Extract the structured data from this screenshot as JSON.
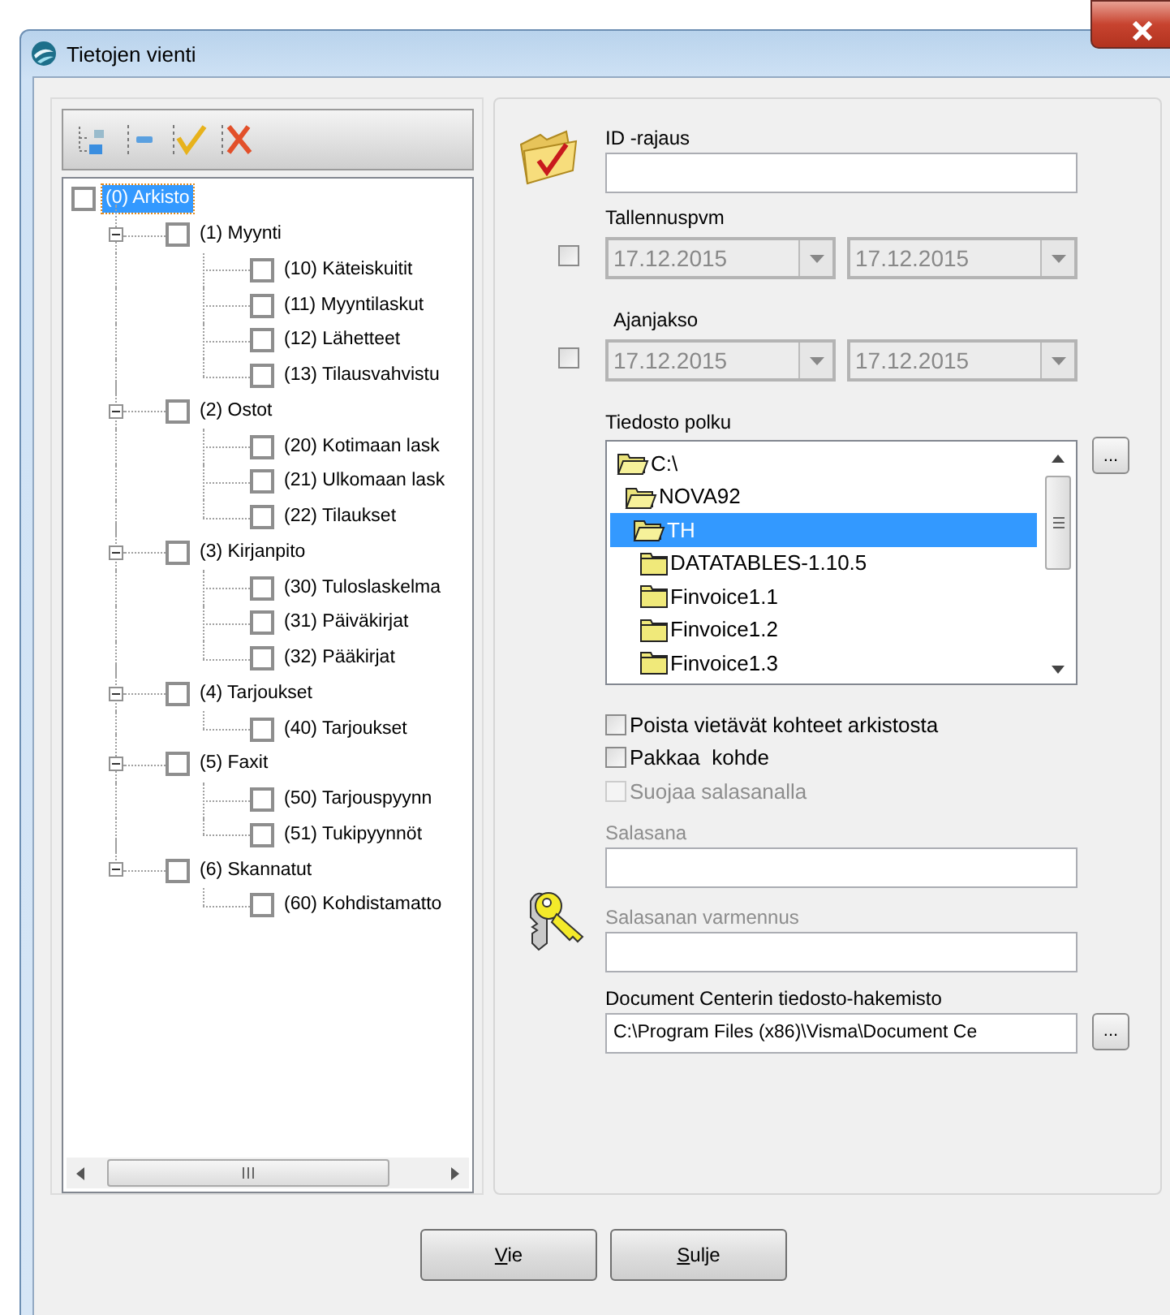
{
  "window": {
    "title": "Tietojen vienti"
  },
  "tree": {
    "items": [
      {
        "label": "(0) Arkisto",
        "checked": false,
        "selected": true,
        "children": [
          {
            "label": "(1) Myynti",
            "checked": false,
            "selected": false,
            "expanded": true,
            "children": [
              {
                "label": "(10) Käteiskuitit",
                "checked": false,
                "selected": false
              },
              {
                "label": "(11) Myyntilaskut",
                "checked": false,
                "selected": false
              },
              {
                "label": "(12) Lähetteet",
                "checked": false,
                "selected": false
              },
              {
                "label": "(13) Tilausvahvistu",
                "checked": false,
                "selected": false
              }
            ]
          },
          {
            "label": "(2) Ostot",
            "checked": false,
            "selected": false,
            "expanded": true,
            "children": [
              {
                "label": "(20) Kotimaan lask",
                "checked": false,
                "selected": false
              },
              {
                "label": "(21) Ulkomaan lask",
                "checked": false,
                "selected": false
              },
              {
                "label": "(22) Tilaukset",
                "checked": false,
                "selected": false
              }
            ]
          },
          {
            "label": "(3) Kirjanpito",
            "checked": false,
            "selected": false,
            "expanded": true,
            "children": [
              {
                "label": "(30) Tuloslaskelma",
                "checked": false,
                "selected": false
              },
              {
                "label": "(31) Päiväkirjat",
                "checked": false,
                "selected": false
              },
              {
                "label": "(32) Pääkirjat",
                "checked": false,
                "selected": false
              }
            ]
          },
          {
            "label": "(4) Tarjoukset",
            "checked": false,
            "selected": false,
            "expanded": true,
            "children": [
              {
                "label": "(40) Tarjoukset",
                "checked": false,
                "selected": false
              }
            ]
          },
          {
            "label": "(5) Faxit",
            "checked": false,
            "selected": false,
            "expanded": true,
            "children": [
              {
                "label": "(50) Tarjouspyynn",
                "checked": false,
                "selected": false
              },
              {
                "label": "(51) Tukipyynnöt",
                "checked": false,
                "selected": false
              }
            ]
          },
          {
            "label": "(6) Skannatut",
            "checked": false,
            "selected": false,
            "expanded": true,
            "children": [
              {
                "label": "(60) Kohdistamatto",
                "checked": false,
                "selected": false
              }
            ]
          }
        ]
      }
    ]
  },
  "id_filter": {
    "label": "ID -rajaus"
  },
  "date_ranges": [
    {
      "label": "Tallennuspvm",
      "checked": false,
      "from": "17.12.2015",
      "to": "17.12.2015"
    },
    {
      "label": "Ajanjakso",
      "checked": false,
      "from": "17.12.2015",
      "to": "17.12.2015"
    }
  ],
  "file_path": {
    "label": "Tiedosto polku",
    "browse": "...",
    "folders": [
      {
        "label": "C:\\",
        "kind": "open",
        "selected": false,
        "children": [
          {
            "label": "NOVA92",
            "kind": "open",
            "selected": false,
            "children": [
              {
                "label": "TH",
                "kind": "open",
                "selected": true,
                "children": [
                  {
                    "label": "DATATABLES-1.10.5",
                    "kind": "closed",
                    "selected": false
                  },
                  {
                    "label": "Finvoice1.1",
                    "kind": "closed",
                    "selected": false
                  },
                  {
                    "label": "Finvoice1.2",
                    "kind": "closed",
                    "selected": false
                  },
                  {
                    "label": "Finvoice1.3",
                    "kind": "closed",
                    "selected": false
                  }
                ]
              }
            ]
          }
        ]
      }
    ]
  },
  "options": [
    {
      "label": "Poista vietävät kohteet arkistosta",
      "checked": false,
      "disabled": false
    },
    {
      "label": "Pakkaa  kohde",
      "checked": false,
      "disabled": false
    },
    {
      "label": "Suojaa salasanalla",
      "checked": false,
      "disabled": true
    }
  ],
  "password": {
    "label": "Salasana",
    "disabled": true
  },
  "password_confirm": {
    "label": "Salasanan varmennus",
    "disabled": true
  },
  "document_center": {
    "label": "Document Centerin tiedosto-hakemisto",
    "value": "C:\\Program Files (x86)\\Visma\\Document Ce",
    "browse": "..."
  },
  "buttons": [
    {
      "label": "Vie"
    },
    {
      "label": "Sulje"
    }
  ]
}
